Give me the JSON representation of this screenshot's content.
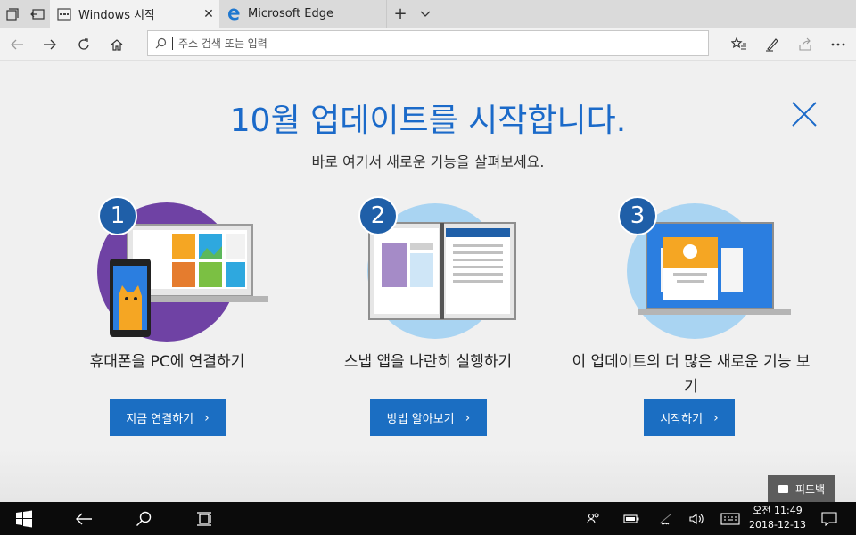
{
  "browser": {
    "tabs": [
      {
        "title": "Windows 시작",
        "active": true
      },
      {
        "title": "Microsoft Edge",
        "active": false
      }
    ],
    "address_placeholder": "주소 검색 또는 입력"
  },
  "page": {
    "headline": "10월 업데이트를 시작합니다.",
    "subline": "바로 여기서 새로운 기능을 살펴보세요.",
    "features": [
      {
        "number": "1",
        "label": "휴대폰을 PC에 연결하기",
        "button": "지금 연결하기"
      },
      {
        "number": "2",
        "label": "스냅 앱을 나란히 실행하기",
        "button": "방법 알아보기"
      },
      {
        "number": "3",
        "label_line1": "이 업데이트의 더 많은 새로운 기능 보",
        "label_line2": "기",
        "button": "시작하기"
      }
    ],
    "feedback_label": "피드백"
  },
  "taskbar": {
    "time": "오전 11:49",
    "date": "2018-12-13"
  },
  "colors": {
    "accent": "#1b6ac9",
    "button": "#1b6ec2",
    "badge": "#1f5fa8",
    "purple": "#6f42a4",
    "light_blue": "#a9d4f2",
    "orange": "#f5a623"
  }
}
